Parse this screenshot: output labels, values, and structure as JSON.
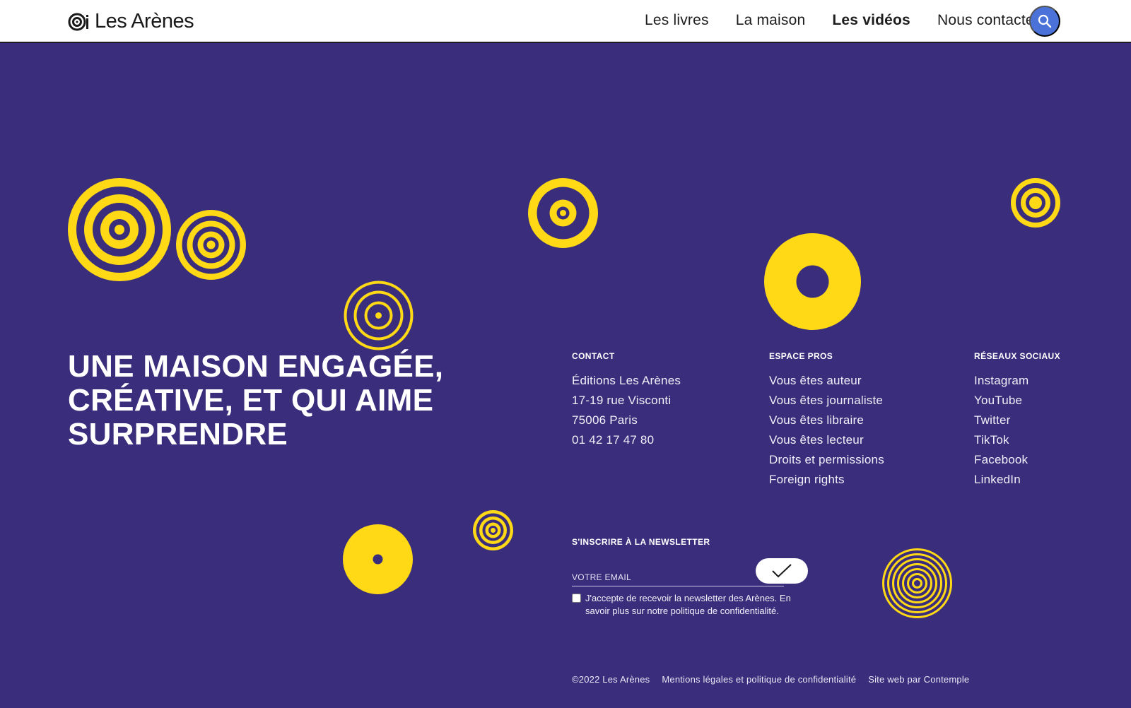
{
  "header": {
    "logo_text": "Les Arènes",
    "nav": [
      {
        "label": "Les livres",
        "active": false
      },
      {
        "label": "La maison",
        "active": false
      },
      {
        "label": "Les vidéos",
        "active": true
      },
      {
        "label": "Nous contacter",
        "active": false
      }
    ],
    "search_icon": "search-icon"
  },
  "colors": {
    "background": "#3a2e7c",
    "accent_yellow": "#ffd915",
    "search_button": "#4a72d9"
  },
  "tagline": "UNE MAISON ENGAGÉE, CRÉATIVE, ET QUI AIME SURPRENDRE",
  "contact": {
    "title": "CONTACT",
    "lines": [
      "Éditions Les Arènes",
      "17-19 rue Visconti",
      "75006 Paris",
      "01 42 17 47 80"
    ]
  },
  "espace_pros": {
    "title": "ESPACE PROS",
    "links": [
      "Vous êtes auteur",
      "Vous êtes journaliste",
      "Vous êtes libraire",
      "Vous êtes lecteur",
      "Droits et permissions",
      "Foreign rights"
    ]
  },
  "reseaux": {
    "title": "RÉSEAUX SOCIAUX",
    "links": [
      "Instagram",
      "YouTube",
      "Twitter",
      "TikTok",
      "Facebook",
      "LinkedIn"
    ]
  },
  "newsletter": {
    "title": "S'INSCRIRE À LA NEWSLETTER",
    "email_placeholder": "VOTRE EMAIL",
    "submit_icon": "checkmark-icon",
    "consent": "J'accepte de recevoir la newsletter des Arènes. En savoir plus sur notre politique de confidentialité.",
    "consent_checked": false
  },
  "footer": {
    "copyright": "©2022 Les Arènes",
    "legal": "Mentions légales et politique de confidentialité",
    "credit": "Site web par Contemple"
  }
}
